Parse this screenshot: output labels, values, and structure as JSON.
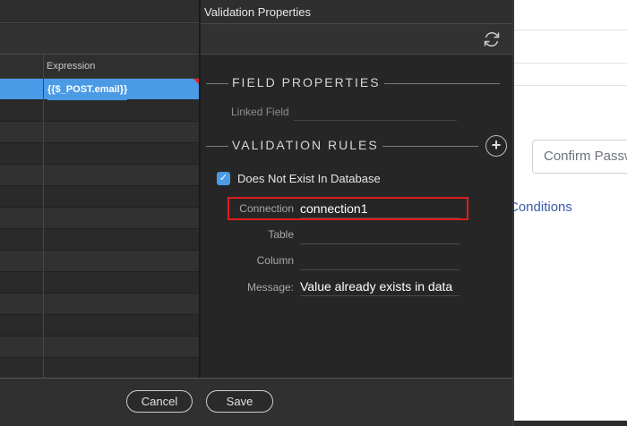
{
  "background": {
    "input_text": "Confirm Passw",
    "link_text": "Conditions"
  },
  "grid": {
    "column_header": "Expression",
    "selected_value": "{{$_POST.email}}"
  },
  "panel": {
    "title": "Validation Properties",
    "toolbar_icon": "refresh-icon",
    "field_properties": {
      "header": "FIELD PROPERTIES",
      "linked_field_label": "Linked Field"
    },
    "validation_rules": {
      "header": "VALIDATION RULES",
      "add_icon": "plus-circle-icon",
      "rule_checked": true,
      "rule_label": "Does Not Exist In Database",
      "connection_label": "Connection",
      "connection_value": "connection1",
      "table_label": "Table",
      "table_value": "",
      "column_label": "Column",
      "column_value": "",
      "message_label": "Message:",
      "message_value": "Value already exists in data"
    }
  },
  "footer": {
    "cancel_label": "Cancel",
    "save_label": "Save"
  },
  "colors": {
    "accent": "#4a9ae6",
    "highlight": "#e01e1e",
    "link": "#3b5ba7"
  }
}
